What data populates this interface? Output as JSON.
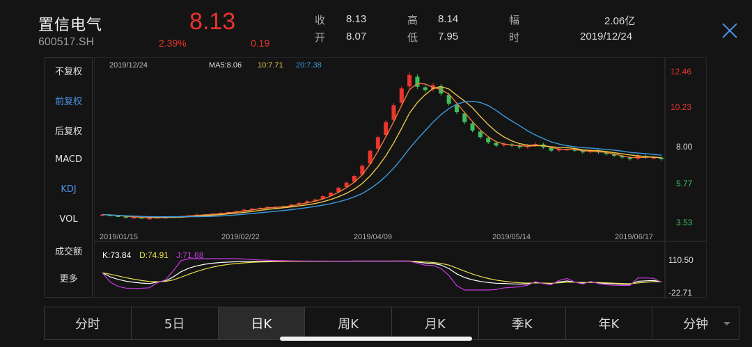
{
  "stock": {
    "name": "置信电气",
    "code": "600517.SH",
    "price": "8.13",
    "change_pct": "2.39%",
    "change_amt": "0.19"
  },
  "quote": {
    "close_label": "收",
    "close": "8.13",
    "open_label": "开",
    "open": "8.07",
    "high_label": "高",
    "high": "8.14",
    "low_label": "低",
    "low": "7.95",
    "amount_label": "幅",
    "amount": "2.06亿",
    "date_label": "时",
    "date": "2019/12/24"
  },
  "menu": {
    "items": [
      "不复权",
      "前复权",
      "后复权",
      "MACD",
      "KDJ",
      "VOL",
      "成交额",
      "更多"
    ],
    "active": [
      "前复权",
      "KDJ"
    ]
  },
  "chart": {
    "top_date": "2019/12/24",
    "ma_label": "MA5:8.06",
    "ma10_label": "10:7.71",
    "ma20_label": "20:7.38",
    "price_axis": [
      "12.46",
      "10.23",
      "8.00",
      "5.77",
      "3.53"
    ],
    "date_axis": [
      "2019/01/15",
      "2019/02/22",
      "2019/04/09",
      "2019/05/14",
      "2019/06/17"
    ],
    "kdj_label": {
      "k": "K:73.84",
      "d": "D:74.91",
      "j": "J:71.68"
    },
    "kdj_axis": [
      "110.50",
      "-22.71"
    ]
  },
  "tabs": {
    "items": [
      "分时",
      "5日",
      "日K",
      "周K",
      "月K",
      "季K",
      "年K",
      "分钟"
    ],
    "active": "日K"
  },
  "colors": {
    "up": "#e8352d",
    "down": "#3cbf5a",
    "ma5": "#f07a3a",
    "ma10": "#e8c34a",
    "ma20": "#3a9be0",
    "k": "#ffffff",
    "d": "#e8e04a",
    "j": "#c83ce0",
    "accent": "#4a90e2"
  },
  "chart_data": [
    {
      "type": "candlestick",
      "title": "",
      "ylim": [
        3.53,
        12.46
      ],
      "x_ticks": [
        "2019/01/15",
        "2019/02/22",
        "2019/04/09",
        "2019/05/14",
        "2019/06/17"
      ],
      "series": [
        {
          "name": "MA5",
          "last": 8.06
        },
        {
          "name": "10",
          "last": 7.71
        },
        {
          "name": "20",
          "last": 7.38
        }
      ],
      "close_approx": [
        4.0,
        3.95,
        3.9,
        3.85,
        3.85,
        3.8,
        3.8,
        3.85,
        3.85,
        3.9,
        3.9,
        3.95,
        4.0,
        4.0,
        4.05,
        4.1,
        4.15,
        4.2,
        4.3,
        4.35,
        4.4,
        4.45,
        4.45,
        4.5,
        4.6,
        4.7,
        4.8,
        4.9,
        5.1,
        5.3,
        5.6,
        5.9,
        6.3,
        6.9,
        7.8,
        8.6,
        9.5,
        10.5,
        11.5,
        12.3,
        11.6,
        11.4,
        11.7,
        11.2,
        10.6,
        10.1,
        9.5,
        9.0,
        8.6,
        8.3,
        8.1,
        8.2,
        8.1,
        8.0,
        8.1,
        8.2,
        8.0,
        7.8,
        7.9,
        7.9,
        7.8,
        7.7,
        7.8,
        7.7,
        7.6,
        7.5,
        7.4,
        7.3,
        7.5,
        7.4,
        7.4,
        7.3
      ]
    },
    {
      "type": "line",
      "title": "",
      "ylim": [
        -22.71,
        110.5
      ],
      "series": [
        {
          "name": "K",
          "last": 73.84
        },
        {
          "name": "D",
          "last": 74.91
        },
        {
          "name": "J",
          "last": 71.68
        }
      ]
    }
  ]
}
